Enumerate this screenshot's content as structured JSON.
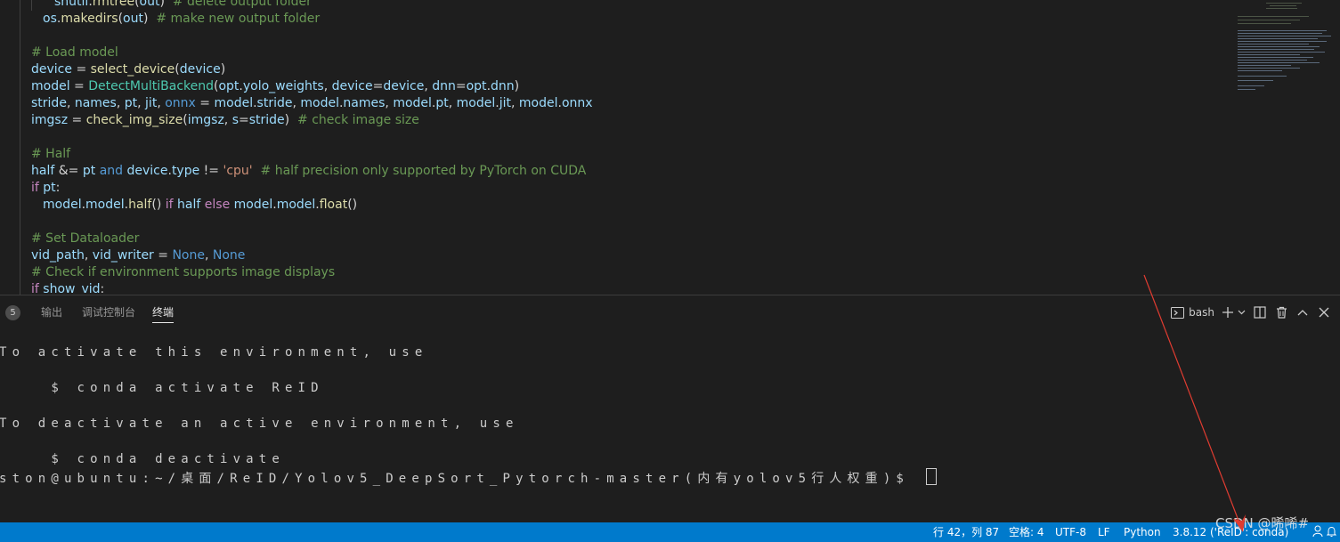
{
  "editor": {
    "lines": [
      {
        "indent": 2,
        "tokens": [
          [
            "shutil",
            "var"
          ],
          [
            ".",
            ""
          ],
          [
            "rmtree",
            "fn"
          ],
          [
            "(",
            ""
          ],
          [
            "out",
            "var"
          ],
          [
            ")  ",
            ""
          ],
          [
            "# delete output folder",
            "cmt"
          ]
        ]
      },
      {
        "indent": 1,
        "tokens": [
          [
            "os",
            "var"
          ],
          [
            ".",
            ""
          ],
          [
            "makedirs",
            "fn"
          ],
          [
            "(",
            ""
          ],
          [
            "out",
            "var"
          ],
          [
            ")  ",
            ""
          ],
          [
            "# make new output folder",
            "cmt"
          ]
        ]
      },
      {
        "indent": 0,
        "tokens": []
      },
      {
        "indent": 0,
        "tokens": [
          [
            "# Load model",
            "cmt"
          ]
        ]
      },
      {
        "indent": 0,
        "tokens": [
          [
            "device",
            "var"
          ],
          [
            " = ",
            ""
          ],
          [
            "select_device",
            "fn"
          ],
          [
            "(",
            ""
          ],
          [
            "device",
            "var"
          ],
          [
            ")",
            ""
          ]
        ]
      },
      {
        "indent": 0,
        "tokens": [
          [
            "model",
            "var"
          ],
          [
            " = ",
            ""
          ],
          [
            "DetectMultiBackend",
            "cls"
          ],
          [
            "(",
            ""
          ],
          [
            "opt",
            "var"
          ],
          [
            ".",
            ""
          ],
          [
            "yolo_weights",
            "var"
          ],
          [
            ", ",
            ""
          ],
          [
            "device",
            "var"
          ],
          [
            "=",
            ""
          ],
          [
            "device",
            "var"
          ],
          [
            ", ",
            ""
          ],
          [
            "dnn",
            "var"
          ],
          [
            "=",
            ""
          ],
          [
            "opt",
            "var"
          ],
          [
            ".",
            ""
          ],
          [
            "dnn",
            "var"
          ],
          [
            ")",
            ""
          ]
        ]
      },
      {
        "indent": 0,
        "tokens": [
          [
            "stride",
            "var"
          ],
          [
            ", ",
            ""
          ],
          [
            "names",
            "var"
          ],
          [
            ", ",
            ""
          ],
          [
            "pt",
            "var"
          ],
          [
            ", ",
            ""
          ],
          [
            "jit",
            "var"
          ],
          [
            ", ",
            ""
          ],
          [
            "onnx",
            "kw"
          ],
          [
            " = ",
            ""
          ],
          [
            "model",
            "var"
          ],
          [
            ".",
            ""
          ],
          [
            "stride",
            "var"
          ],
          [
            ", ",
            ""
          ],
          [
            "model",
            "var"
          ],
          [
            ".",
            ""
          ],
          [
            "names",
            "var"
          ],
          [
            ", ",
            ""
          ],
          [
            "model",
            "var"
          ],
          [
            ".",
            ""
          ],
          [
            "pt",
            "var"
          ],
          [
            ", ",
            ""
          ],
          [
            "model",
            "var"
          ],
          [
            ".",
            ""
          ],
          [
            "jit",
            "var"
          ],
          [
            ", ",
            ""
          ],
          [
            "model",
            "var"
          ],
          [
            ".",
            ""
          ],
          [
            "onnx",
            "var"
          ]
        ]
      },
      {
        "indent": 0,
        "tokens": [
          [
            "imgsz",
            "var"
          ],
          [
            " = ",
            ""
          ],
          [
            "check_img_size",
            "fn"
          ],
          [
            "(",
            ""
          ],
          [
            "imgsz",
            "var"
          ],
          [
            ", ",
            ""
          ],
          [
            "s",
            "var"
          ],
          [
            "=",
            ""
          ],
          [
            "stride",
            "var"
          ],
          [
            ")  ",
            ""
          ],
          [
            "# check image size",
            "cmt"
          ]
        ]
      },
      {
        "indent": 0,
        "tokens": []
      },
      {
        "indent": 0,
        "tokens": [
          [
            "# Half",
            "cmt"
          ]
        ]
      },
      {
        "indent": 0,
        "tokens": [
          [
            "half",
            "var"
          ],
          [
            " &= ",
            ""
          ],
          [
            "pt",
            "var"
          ],
          [
            " ",
            ""
          ],
          [
            "and",
            "kw"
          ],
          [
            " ",
            ""
          ],
          [
            "device",
            "var"
          ],
          [
            ".",
            ""
          ],
          [
            "type",
            "var"
          ],
          [
            " != ",
            ""
          ],
          [
            "'cpu'",
            "str"
          ],
          [
            "  ",
            ""
          ],
          [
            "# half precision only supported by PyTorch on CUDA",
            "cmt"
          ]
        ]
      },
      {
        "indent": 0,
        "tokens": [
          [
            "if",
            "ctl"
          ],
          [
            " ",
            ""
          ],
          [
            "pt",
            "var"
          ],
          [
            ":",
            ""
          ]
        ]
      },
      {
        "indent": 1,
        "tokens": [
          [
            "model",
            "var"
          ],
          [
            ".",
            ""
          ],
          [
            "model",
            "var"
          ],
          [
            ".",
            ""
          ],
          [
            "half",
            "fn"
          ],
          [
            "() ",
            ""
          ],
          [
            "if",
            "ctl"
          ],
          [
            " ",
            ""
          ],
          [
            "half",
            "var"
          ],
          [
            " ",
            ""
          ],
          [
            "else",
            "ctl"
          ],
          [
            " ",
            ""
          ],
          [
            "model",
            "var"
          ],
          [
            ".",
            ""
          ],
          [
            "model",
            "var"
          ],
          [
            ".",
            ""
          ],
          [
            "float",
            "fn"
          ],
          [
            "()",
            ""
          ]
        ]
      },
      {
        "indent": 0,
        "tokens": []
      },
      {
        "indent": 0,
        "tokens": [
          [
            "# Set Dataloader",
            "cmt"
          ]
        ]
      },
      {
        "indent": 0,
        "tokens": [
          [
            "vid_path",
            "var"
          ],
          [
            ", ",
            ""
          ],
          [
            "vid_writer",
            "var"
          ],
          [
            " = ",
            ""
          ],
          [
            "None",
            "kw"
          ],
          [
            ", ",
            ""
          ],
          [
            "None",
            "kw"
          ]
        ]
      },
      {
        "indent": 0,
        "tokens": [
          [
            "# Check if environment supports image displays",
            "cmt"
          ]
        ]
      },
      {
        "indent": 0,
        "tokens": [
          [
            "if",
            "ctl"
          ],
          [
            " ",
            ""
          ],
          [
            "show_vid",
            "var"
          ],
          [
            ":",
            ""
          ]
        ]
      }
    ]
  },
  "panel": {
    "badge": "5",
    "tabs": [
      {
        "label": "输出"
      },
      {
        "label": "调试控制台"
      },
      {
        "label": "终端"
      }
    ],
    "shell_label": "bash",
    "terminal_lines": [
      "To activate this environment, use",
      "    $ conda activate ReID",
      "To deactivate an active environment, use",
      "    $ conda deactivate",
      "ston@ubuntu:~/桌面/ReID/Yolov5_DeepSort_Pytorch-master(内有yolov5行人权重)$ "
    ]
  },
  "statusbar": {
    "position": "行 42，列 87",
    "spaces": "空格: 4",
    "encoding": "UTF-8",
    "eol": "LF",
    "language": "Python",
    "interpreter": "3.8.12 ('ReID': conda)"
  },
  "watermark": "CSDN @晞唏#",
  "colors": {
    "statusbar": "#007acc",
    "arrow": "#e03c31",
    "editor_bg": "#1e1e1e"
  }
}
